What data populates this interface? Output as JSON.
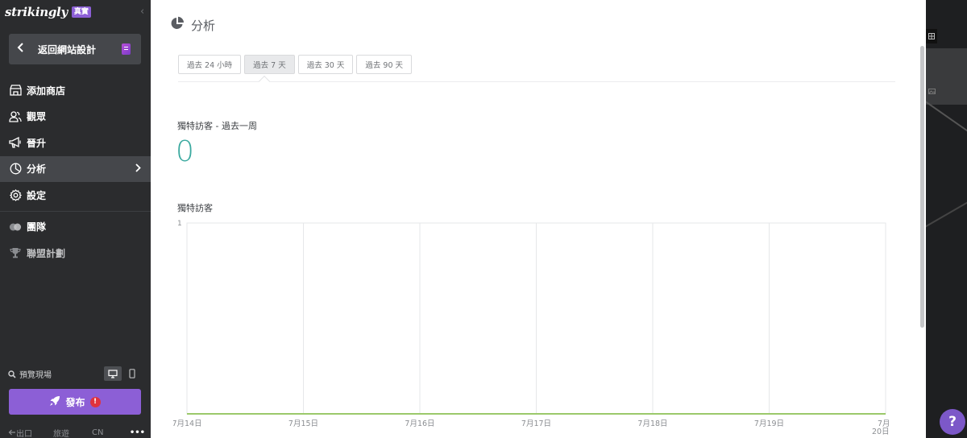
{
  "sidebar": {
    "brand": "strikingly",
    "badge": "真實",
    "collapse_glyph": "‹",
    "back_label": "返回網站設計",
    "items": [
      {
        "label": "添加商店",
        "icon": "store-icon"
      },
      {
        "label": "觀眾",
        "icon": "audience-icon"
      },
      {
        "label": "晉升",
        "icon": "megaphone-icon"
      },
      {
        "label": "分析",
        "icon": "pie-chart-icon"
      },
      {
        "label": "設定",
        "icon": "gear-icon"
      },
      {
        "label": "團隊",
        "icon": "team-icon"
      },
      {
        "label": "聯盟計劃",
        "icon": "trophy-icon"
      }
    ],
    "preview_label": "預覽現場",
    "publish_label": "發布",
    "publish_alert": "!",
    "bottom": {
      "exit": "出口",
      "ios": "旅遊",
      "lang": "CN",
      "more": "•••"
    }
  },
  "main": {
    "title": "分析",
    "tabs": [
      "過去 24 小時",
      "過去 7 天",
      "過去 30 天",
      "過去 90 天"
    ],
    "active_tab": 1,
    "stat_label": "獨特訪客 - 過去一周",
    "stat_value": "0",
    "chart_title": "獨特訪客"
  },
  "help_label": "?",
  "colors": {
    "accent": "#8c5fd6",
    "stat": "#3aa99f",
    "line": "#9bc96b",
    "sidebar": "#2b2c2e"
  },
  "chart_data": {
    "type": "line",
    "x": [
      "7月14日",
      "7月15日",
      "7月16日",
      "7月17日",
      "7月18日",
      "7月19日",
      "7月20日"
    ],
    "series": [
      {
        "values": [
          0,
          0,
          0,
          0,
          0,
          0,
          0
        ]
      }
    ],
    "ylim": [
      0,
      1
    ],
    "yticks": [
      "1"
    ],
    "grid": true
  }
}
